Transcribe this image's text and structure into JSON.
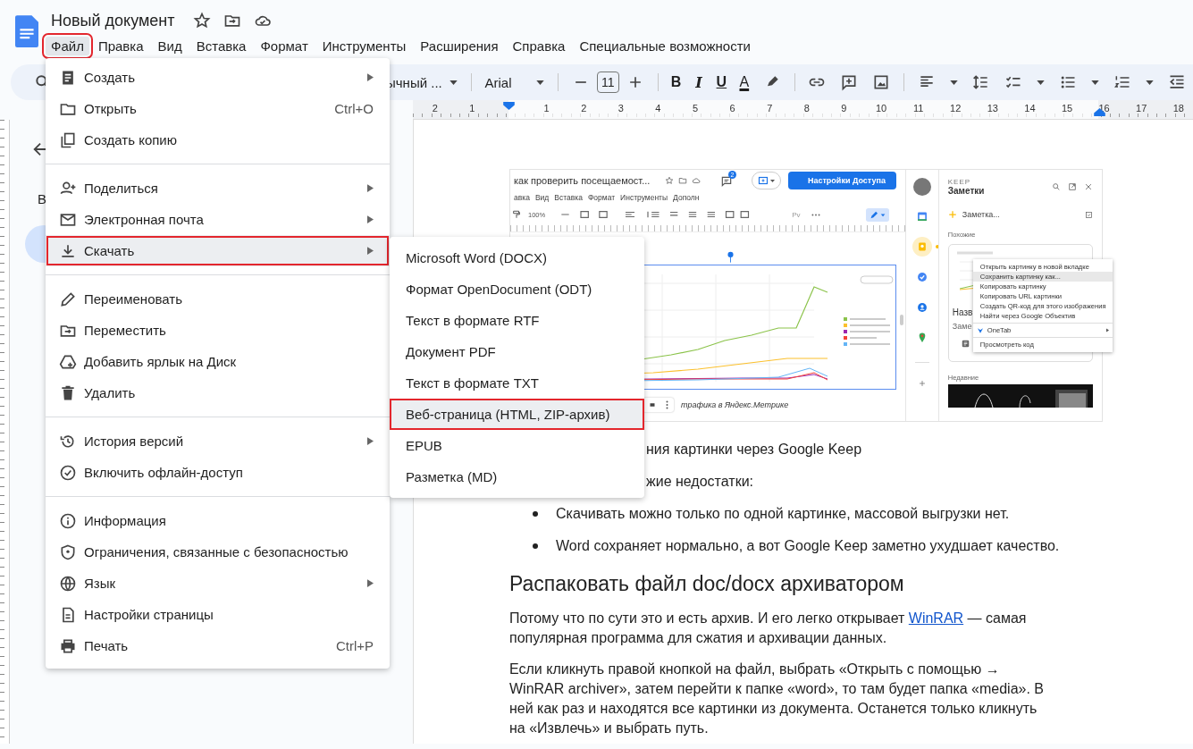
{
  "app": {
    "title": "Новый документ"
  },
  "menubar": [
    {
      "label": "Файл",
      "selected": true,
      "marked": true
    },
    {
      "label": "Правка",
      "selected": false,
      "marked": false
    },
    {
      "label": "Вид",
      "selected": false,
      "marked": false
    },
    {
      "label": "Вставка",
      "selected": false,
      "marked": false
    },
    {
      "label": "Формат",
      "selected": false,
      "marked": false
    },
    {
      "label": "Инструменты",
      "selected": false,
      "marked": false
    },
    {
      "label": "Расширения",
      "selected": false,
      "marked": false
    },
    {
      "label": "Справка",
      "selected": false,
      "marked": false
    },
    {
      "label": "Специальные возможности",
      "selected": false,
      "marked": false
    }
  ],
  "toolbar": {
    "style": "ычный ...",
    "font": "Arial",
    "font_size": "11",
    "format": [
      "B",
      "I",
      "U",
      "A"
    ]
  },
  "ruler": {
    "labels": [
      "2",
      "1",
      "1",
      "2",
      "3",
      "4",
      "5",
      "6",
      "7",
      "8",
      "9",
      "10",
      "11",
      "12",
      "13",
      "14",
      "15",
      "16",
      "17",
      "18"
    ]
  },
  "outline": {
    "heading": "В"
  },
  "file_menu": {
    "sections": [
      [
        {
          "label": "Создать",
          "submenu": true,
          "selected": false,
          "marked": false
        },
        {
          "label": "Открыть",
          "shortcut": "Ctrl+O",
          "submenu": false,
          "selected": false,
          "marked": false
        },
        {
          "label": "Создать копию",
          "submenu": false,
          "selected": false,
          "marked": false
        }
      ],
      [
        {
          "label": "Поделиться",
          "submenu": true,
          "selected": false,
          "marked": false
        },
        {
          "label": "Электронная почта",
          "submenu": true,
          "selected": false,
          "marked": false
        },
        {
          "label": "Скачать",
          "submenu": true,
          "selected": true,
          "marked": true
        }
      ],
      [
        {
          "label": "Переименовать",
          "submenu": false,
          "selected": false,
          "marked": false
        },
        {
          "label": "Переместить",
          "submenu": false,
          "selected": false,
          "marked": false
        },
        {
          "label": "Добавить ярлык на Диск",
          "submenu": false,
          "selected": false,
          "marked": false
        },
        {
          "label": "Удалить",
          "submenu": false,
          "selected": false,
          "marked": false
        }
      ],
      [
        {
          "label": "История версий",
          "submenu": true,
          "selected": false,
          "marked": false
        },
        {
          "label": "Включить офлайн-доступ",
          "submenu": false,
          "selected": false,
          "marked": false
        }
      ],
      [
        {
          "label": "Информация",
          "submenu": false,
          "selected": false,
          "marked": false
        },
        {
          "label": "Ограничения, связанные с безопасностью",
          "submenu": false,
          "selected": false,
          "marked": false
        },
        {
          "label": "Язык",
          "submenu": true,
          "selected": false,
          "marked": false
        },
        {
          "label": "Настройки страницы",
          "submenu": false,
          "selected": false,
          "marked": false
        },
        {
          "label": "Печать",
          "shortcut": "Ctrl+P",
          "submenu": false,
          "selected": false,
          "marked": false
        }
      ]
    ]
  },
  "download_menu": [
    {
      "label": "Microsoft Word (DOCX)",
      "selected": false,
      "marked": false
    },
    {
      "label": "Формат OpenDocument (ODT)",
      "selected": false,
      "marked": false
    },
    {
      "label": "Текст в формате RTF",
      "selected": false,
      "marked": false
    },
    {
      "label": "Документ PDF",
      "selected": false,
      "marked": false
    },
    {
      "label": "Текст в формате TXT",
      "selected": false,
      "marked": false
    },
    {
      "label": "Веб-страница (HTML, ZIP-архив)",
      "selected": true,
      "marked": true
    },
    {
      "label": "EPUB",
      "selected": false,
      "marked": false
    },
    {
      "label": "Разметка (MD)",
      "selected": false,
      "marked": false
    }
  ],
  "embedded_screenshot": {
    "doc_title": "как проверить посещаемост...",
    "comment_count": "2",
    "share_button": "Настройки Доступа",
    "menu": [
      "авка",
      "Вид",
      "Вставка",
      "Формат",
      "Инструменты",
      "Дополн"
    ],
    "zoom": "100%",
    "style": "Рv",
    "caption": "трафика в Яндекс.Метрике",
    "side_apps": [
      {
        "selected": false
      },
      {
        "selected": true
      },
      {
        "selected": false
      },
      {
        "selected": false
      },
      {
        "selected": false
      }
    ],
    "keep": {
      "brand": "KEEP",
      "title": "Заметки",
      "new_note": "Заметка...",
      "similar_heading": "Похожие",
      "card_title": "Назв",
      "card_text": "Заме",
      "recent_heading": "Недавние",
      "context_menu": [
        {
          "kind": "item",
          "label": "Открыть картинку в новой вкладке",
          "selected": false
        },
        {
          "kind": "item",
          "label": "Сохранить картинку как...",
          "selected": true
        },
        {
          "kind": "item",
          "label": "Копировать картинку",
          "selected": false
        },
        {
          "kind": "item",
          "label": "Копировать URL картинки",
          "selected": false
        },
        {
          "kind": "item",
          "label": "Создать QR-код для этого изображения",
          "selected": false
        },
        {
          "kind": "item",
          "label": "Найти через Google Объектив",
          "selected": false
        },
        {
          "kind": "divider"
        },
        {
          "kind": "extension",
          "label": "OneTab",
          "selected": false
        },
        {
          "kind": "divider"
        },
        {
          "kind": "item",
          "label": "Просмотреть код",
          "selected": false
        }
      ]
    }
  },
  "body": [
    {
      "kind": "partial",
      "text": "ния картинки через Google Keep"
    },
    {
      "kind": "partial",
      "text": "жие недостатки:"
    },
    {
      "kind": "bullet",
      "text": "Скачивать можно только по одной картинке, массовой выгрузки нет."
    },
    {
      "kind": "bullet",
      "text": "Word сохраняет нормально, а вот Google Keep заметно ухудшает качество."
    },
    {
      "kind": "heading",
      "text": "Распаковать файл doc/docx архиватором"
    },
    {
      "kind": "paragraph",
      "text": "Потому что по сути это и есть архив. И его легко открывает ",
      "link": "WinRAR",
      "after": " — самая популярная программа для сжатия и архивации данных."
    },
    {
      "kind": "paragraph",
      "text": "Если кликнуть правой кнопкой на файл, выбрать «Открыть с помощью → WinRAR archiver», затем перейти к папке «word», то там будет папка «media». В ней как раз и находятся все картинки из документа. Останется только кликнуть на «Извлечь» и выбрать путь."
    }
  ]
}
